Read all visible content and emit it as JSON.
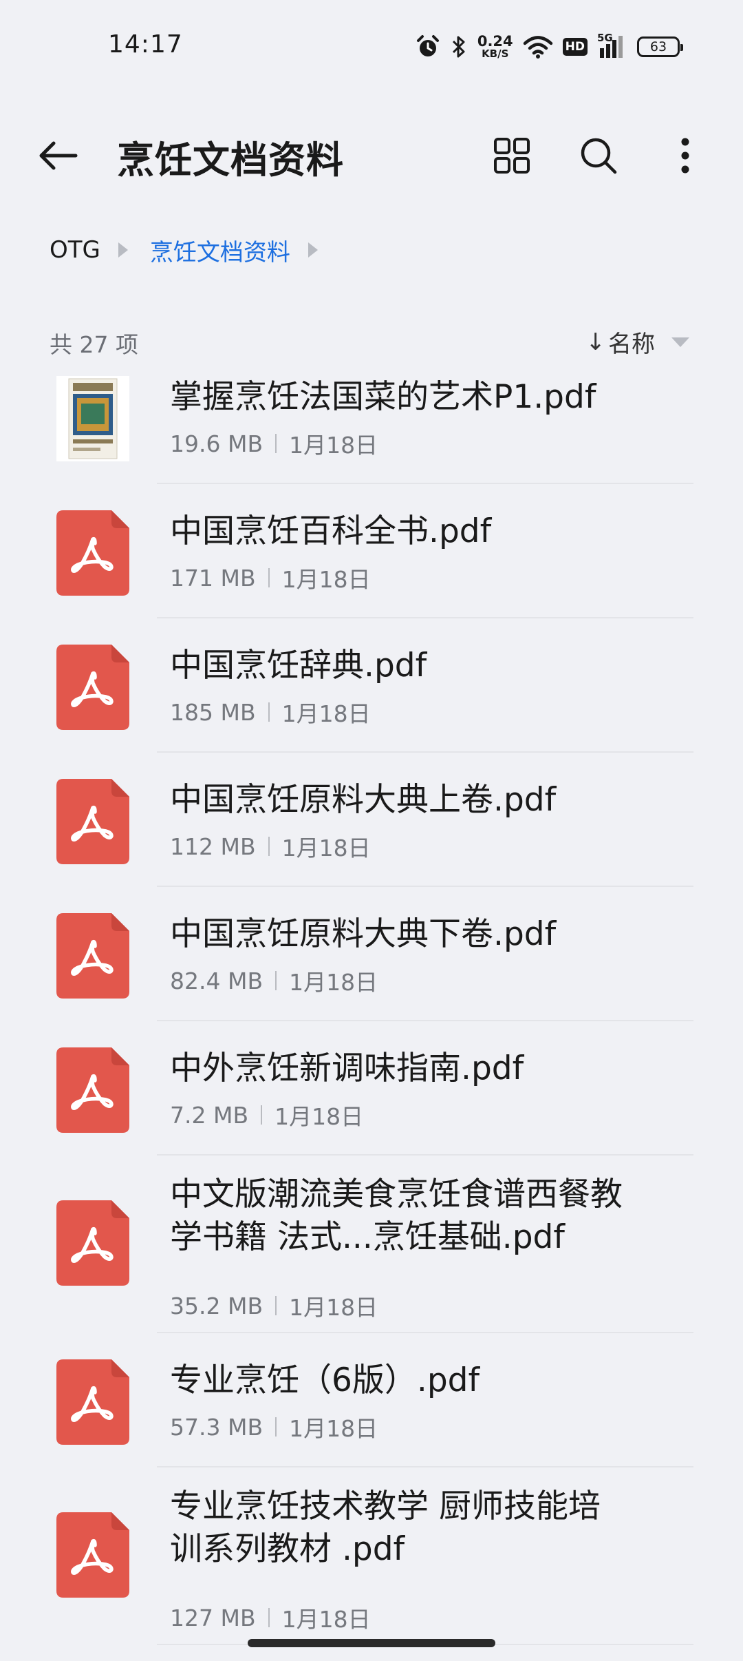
{
  "status_bar": {
    "time": "14:17",
    "network_speed_value": "0.24",
    "network_speed_unit": "KB/S",
    "hd_label": "HD",
    "network_type": "5G",
    "battery_level": "63",
    "icons": [
      "alarm-icon",
      "bluetooth-icon",
      "wifi-icon",
      "hd-badge",
      "signal-icon",
      "battery-icon"
    ]
  },
  "header": {
    "title": "烹饪文档资料",
    "icons": [
      "back-arrow-icon",
      "grid-view-icon",
      "search-icon",
      "more-vertical-icon"
    ]
  },
  "breadcrumb": {
    "items": [
      {
        "label": "OTG"
      },
      {
        "label": "烹饪文档资料"
      }
    ],
    "accent_color": "#1d6fe0"
  },
  "list_header": {
    "count": "共 27 项",
    "sort_label": "名称"
  },
  "files": [
    {
      "name": "掌握烹饪法国菜的艺术P1.pdf",
      "size": "19.6 MB",
      "date": "1月18日",
      "icon": "book-cover-thumbnail"
    },
    {
      "name": "中国烹饪百科全书.pdf",
      "size": "171 MB",
      "date": "1月18日",
      "icon": "pdf-icon"
    },
    {
      "name": "中国烹饪辞典.pdf",
      "size": "185 MB",
      "date": "1月18日",
      "icon": "pdf-icon"
    },
    {
      "name": "中国烹饪原料大典上卷.pdf",
      "size": "112 MB",
      "date": "1月18日",
      "icon": "pdf-icon"
    },
    {
      "name": "中国烹饪原料大典下卷.pdf",
      "size": "82.4 MB",
      "date": "1月18日",
      "icon": "pdf-icon"
    },
    {
      "name": "中外烹饪新调味指南.pdf",
      "size": "7.2 MB",
      "date": "1月18日",
      "icon": "pdf-icon"
    },
    {
      "name": "中文版潮流美食烹饪食谱西餐教学书籍 法式...烹饪基础.pdf",
      "size": "35.2 MB",
      "date": "1月18日",
      "icon": "pdf-icon"
    },
    {
      "name": "专业烹饪（6版）.pdf",
      "size": "57.3 MB",
      "date": "1月18日",
      "icon": "pdf-icon"
    },
    {
      "name": "专业烹饪技术教学 厨师技能培训系列教材 .pdf",
      "size": "127 MB",
      "date": "1月18日",
      "icon": "pdf-icon"
    }
  ],
  "colors": {
    "background": "#f0f1f5",
    "pdf_icon": "#e2574c",
    "text_primary": "#1a1a1a",
    "text_secondary": "#75787e"
  }
}
